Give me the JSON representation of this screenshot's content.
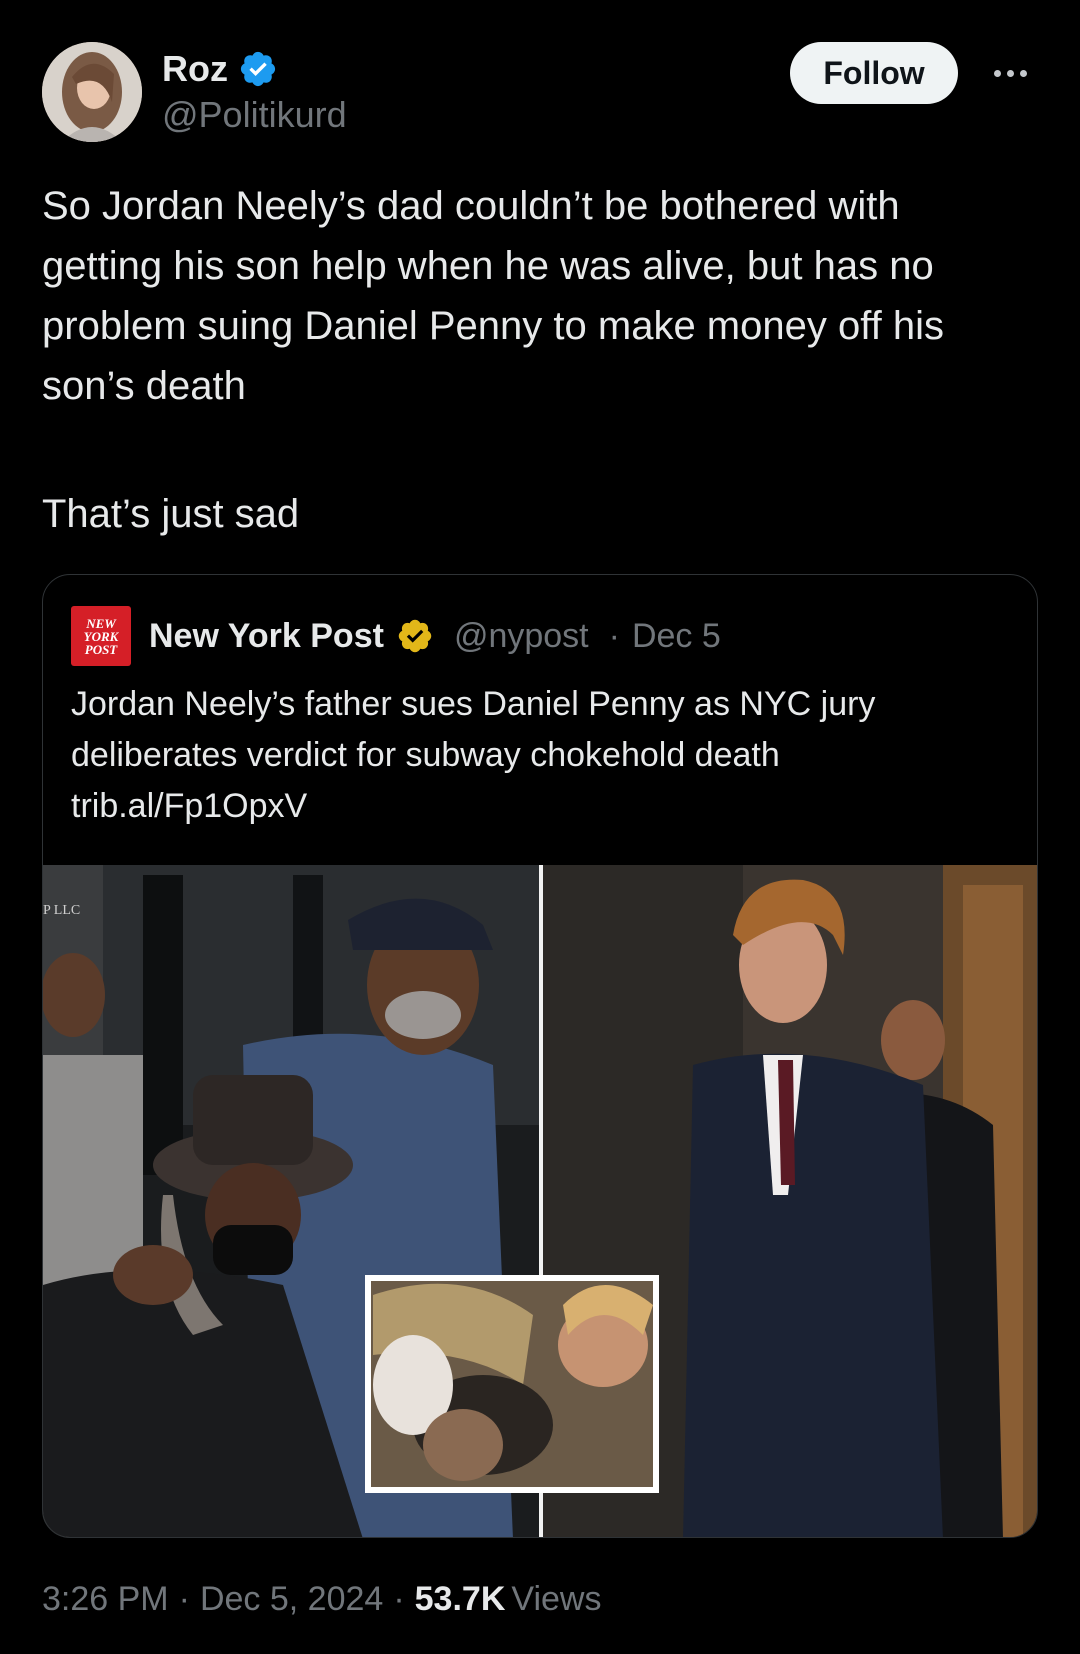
{
  "author": {
    "name": "Roz",
    "handle": "@Politikurd"
  },
  "follow_label": "Follow",
  "tweet": {
    "text": "So Jordan Neely’s dad couldn’t be bothered with getting his son help when he was alive, but has no problem suing Daniel Penny to make money off his son’s death",
    "text2": "That’s just sad"
  },
  "quote": {
    "logo_lines": [
      "NEW",
      "YORK",
      "POST"
    ],
    "name": "New York Post",
    "handle": "@nypost",
    "date": "Dec 5",
    "text": "Jordan Neely’s father sues Daniel Penny as NYC jury deliberates verdict for subway chokehold death",
    "link": "trib.al/Fp1OpxV",
    "sign_text": "P LLC"
  },
  "footer": {
    "time": "3:26 PM",
    "date": "Dec 5, 2024",
    "views_count": "53.7K",
    "views_label": "Views"
  },
  "colors": {
    "background": "#000000",
    "text": "#e7e9ea",
    "muted": "#71767b",
    "verified_blue": "#1d9bf0",
    "verified_gold": "#e2b719",
    "nypost_red": "#d51f27"
  }
}
